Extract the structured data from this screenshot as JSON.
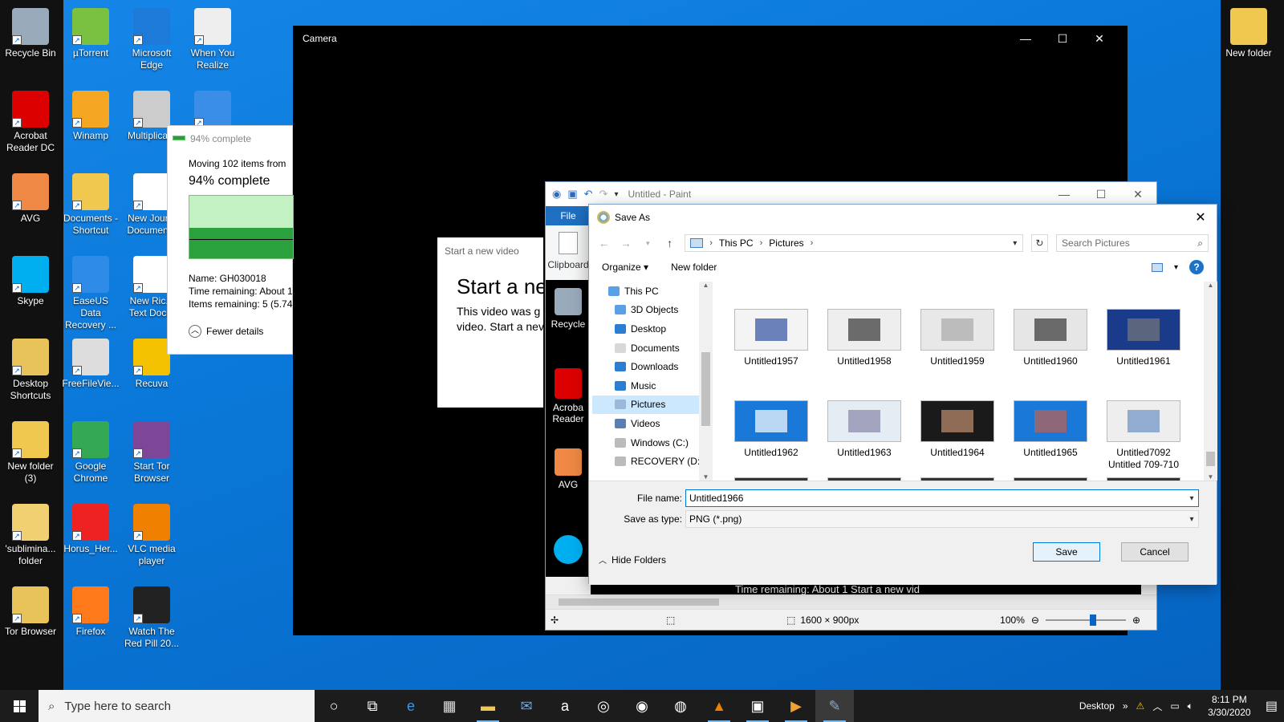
{
  "desktop": {
    "icons_col1": [
      {
        "label": "Recycle Bin",
        "icon": "recycle-bin-icon",
        "color": "#9ab"
      },
      {
        "label": "Acrobat Reader DC",
        "icon": "acrobat-icon",
        "color": "#d00"
      },
      {
        "label": "AVG",
        "icon": "avg-icon",
        "color": "#e84"
      },
      {
        "label": "Skype",
        "icon": "skype-icon",
        "color": "#00aff0"
      },
      {
        "label": "Desktop Shortcuts",
        "icon": "folder-icon",
        "color": "#e8c35a"
      },
      {
        "label": "New folder (3)",
        "icon": "folder-icon",
        "color": "#f0c850"
      },
      {
        "label": "'sublimina... folder",
        "icon": "folder-icon",
        "color": "#f0d070"
      },
      {
        "label": "Tor Browser",
        "icon": "tor-folder-icon",
        "color": "#e8c35a"
      }
    ],
    "icons_col2": [
      {
        "label": "µTorrent",
        "icon": "utorrent-icon",
        "color": "#7ac142"
      },
      {
        "label": "Winamp",
        "icon": "winamp-icon",
        "color": "#f5a623"
      },
      {
        "label": "Documents - Shortcut",
        "icon": "folder-icon",
        "color": "#f0c850"
      },
      {
        "label": "EaseUS Data Recovery ...",
        "icon": "easeus-icon",
        "color": "#2e8ce8"
      },
      {
        "label": "FreeFileVie...",
        "icon": "freefileviewer-icon",
        "color": "#ddd"
      },
      {
        "label": "Google Chrome",
        "icon": "chrome-icon",
        "color": "#34a853"
      },
      {
        "label": "Horus_Her...",
        "icon": "pdf-icon",
        "color": "#e22"
      },
      {
        "label": "Firefox",
        "icon": "firefox-icon",
        "color": "#ff7a1a"
      }
    ],
    "icons_col3": [
      {
        "label": "Microsoft Edge",
        "icon": "edge-icon",
        "color": "#1e7ad8"
      },
      {
        "label": "Multiplica...",
        "icon": "multiplicity-icon",
        "color": "#ccc"
      },
      {
        "label": "New Jour... Documen...",
        "icon": "document-icon",
        "color": "#fff"
      },
      {
        "label": "New Ric... Text Doc...",
        "icon": "rtf-icon",
        "color": "#fff"
      },
      {
        "label": "Recuva",
        "icon": "recuva-icon",
        "color": "#f3c100"
      },
      {
        "label": "Start Tor Browser",
        "icon": "tor-icon",
        "color": "#7d4698"
      },
      {
        "label": "VLC media player",
        "icon": "vlc-icon",
        "color": "#f08000"
      },
      {
        "label": "Watch The Red Pill 20...",
        "icon": "video-icon",
        "color": "#222"
      }
    ],
    "icons_col4": [
      {
        "label": "When You Realize",
        "icon": "gradient-file-icon",
        "color": "#eee"
      },
      {
        "label": "",
        "icon": "windows-shield-icon",
        "color": "#3a8ee6"
      }
    ],
    "right_icon": {
      "label": "New folder",
      "icon": "folder-icon",
      "color": "#f0c850"
    }
  },
  "camera": {
    "title": "Camera"
  },
  "progress": {
    "header": "94% complete",
    "moving": "Moving 102 items from",
    "big": "94% complete",
    "name": "Name:  GH030018",
    "time": "Time remaining:  About 1",
    "items": "Items remaining:  5 (5.74",
    "fewer": "Fewer details",
    "progress_pct": 94
  },
  "newvideo": {
    "small": "Start a new video",
    "title": "Start a ne",
    "line1": "This video was g",
    "line2": "video. Start a nev"
  },
  "paint": {
    "title": "Untitled - Paint",
    "file_tab": "File",
    "clipboard": "Clipboard",
    "canvas_labels": [
      "Recycle",
      "Acroba Reader",
      "AVG"
    ],
    "peek": "Time remaining: About 1              Start a new vid",
    "status_size": "1600 × 900px",
    "zoom": "100%"
  },
  "saveas": {
    "title": "Save As",
    "path": [
      "This PC",
      "Pictures"
    ],
    "search_placeholder": "Search Pictures",
    "organize": "Organize ▾",
    "new_folder": "New folder",
    "tree": [
      {
        "label": "This PC",
        "icon": "computer-icon",
        "color": "#5aa0e6"
      },
      {
        "label": "3D Objects",
        "icon": "cube-icon",
        "color": "#5aa0e6"
      },
      {
        "label": "Desktop",
        "icon": "desktop-icon",
        "color": "#2a7fd4"
      },
      {
        "label": "Documents",
        "icon": "documents-icon",
        "color": "#d8d8d8"
      },
      {
        "label": "Downloads",
        "icon": "download-icon",
        "color": "#2a7fd4"
      },
      {
        "label": "Music",
        "icon": "music-icon",
        "color": "#2a7fd4"
      },
      {
        "label": "Pictures",
        "icon": "pictures-icon",
        "color": "#9ab8d8"
      },
      {
        "label": "Videos",
        "icon": "videos-icon",
        "color": "#5a7fb0"
      },
      {
        "label": "Windows (C:)",
        "icon": "drive-icon",
        "color": "#bbb"
      },
      {
        "label": "RECOVERY (D:)",
        "icon": "drive-icon",
        "color": "#bbb"
      }
    ],
    "files": [
      {
        "name": "Untitled1957",
        "bg": "#f4f4f4",
        "accent": "#3050a0"
      },
      {
        "name": "Untitled1958",
        "bg": "#eeeeee",
        "accent": "#333"
      },
      {
        "name": "Untitled1959",
        "bg": "#e8e8e8",
        "accent": "#aaa"
      },
      {
        "name": "Untitled1960",
        "bg": "#e6e6e6",
        "accent": "#333"
      },
      {
        "name": "Untitled1961",
        "bg": "#1a3a8a",
        "accent": "#777"
      },
      {
        "name": "Untitled1962",
        "bg": "#1a78d8",
        "accent": "#fff"
      },
      {
        "name": "Untitled1963",
        "bg": "#e4ecf4",
        "accent": "#88a"
      },
      {
        "name": "Untitled1964",
        "bg": "#1a1a1a",
        "accent": "#c09070"
      },
      {
        "name": "Untitled1965",
        "bg": "#1a78d8",
        "accent": "#c06050"
      },
      {
        "name": "Untitled7092 Untitled 709-710",
        "bg": "#eeeeee",
        "accent": "#6a90c0"
      }
    ],
    "file_name_label": "File name:",
    "file_name_value": "Untitled1966",
    "type_label": "Save as type:",
    "type_value": "PNG (*.png)",
    "hide_folders": "Hide Folders",
    "save": "Save",
    "cancel": "Cancel"
  },
  "taskbar": {
    "search": "Type here to search",
    "apps": [
      "cortana-icon",
      "task-view-icon",
      "edge-icon",
      "store-icon",
      "file-explorer-icon",
      "mail-icon",
      "amazon-icon",
      "tripadvisor-icon",
      "camera-app-icon",
      "chrome-icon",
      "vlc-icon",
      "camera-icon",
      "video-icon",
      "paint-icon"
    ],
    "desktop_label": "Desktop",
    "time": "8:11 PM",
    "date": "3/30/2020"
  }
}
